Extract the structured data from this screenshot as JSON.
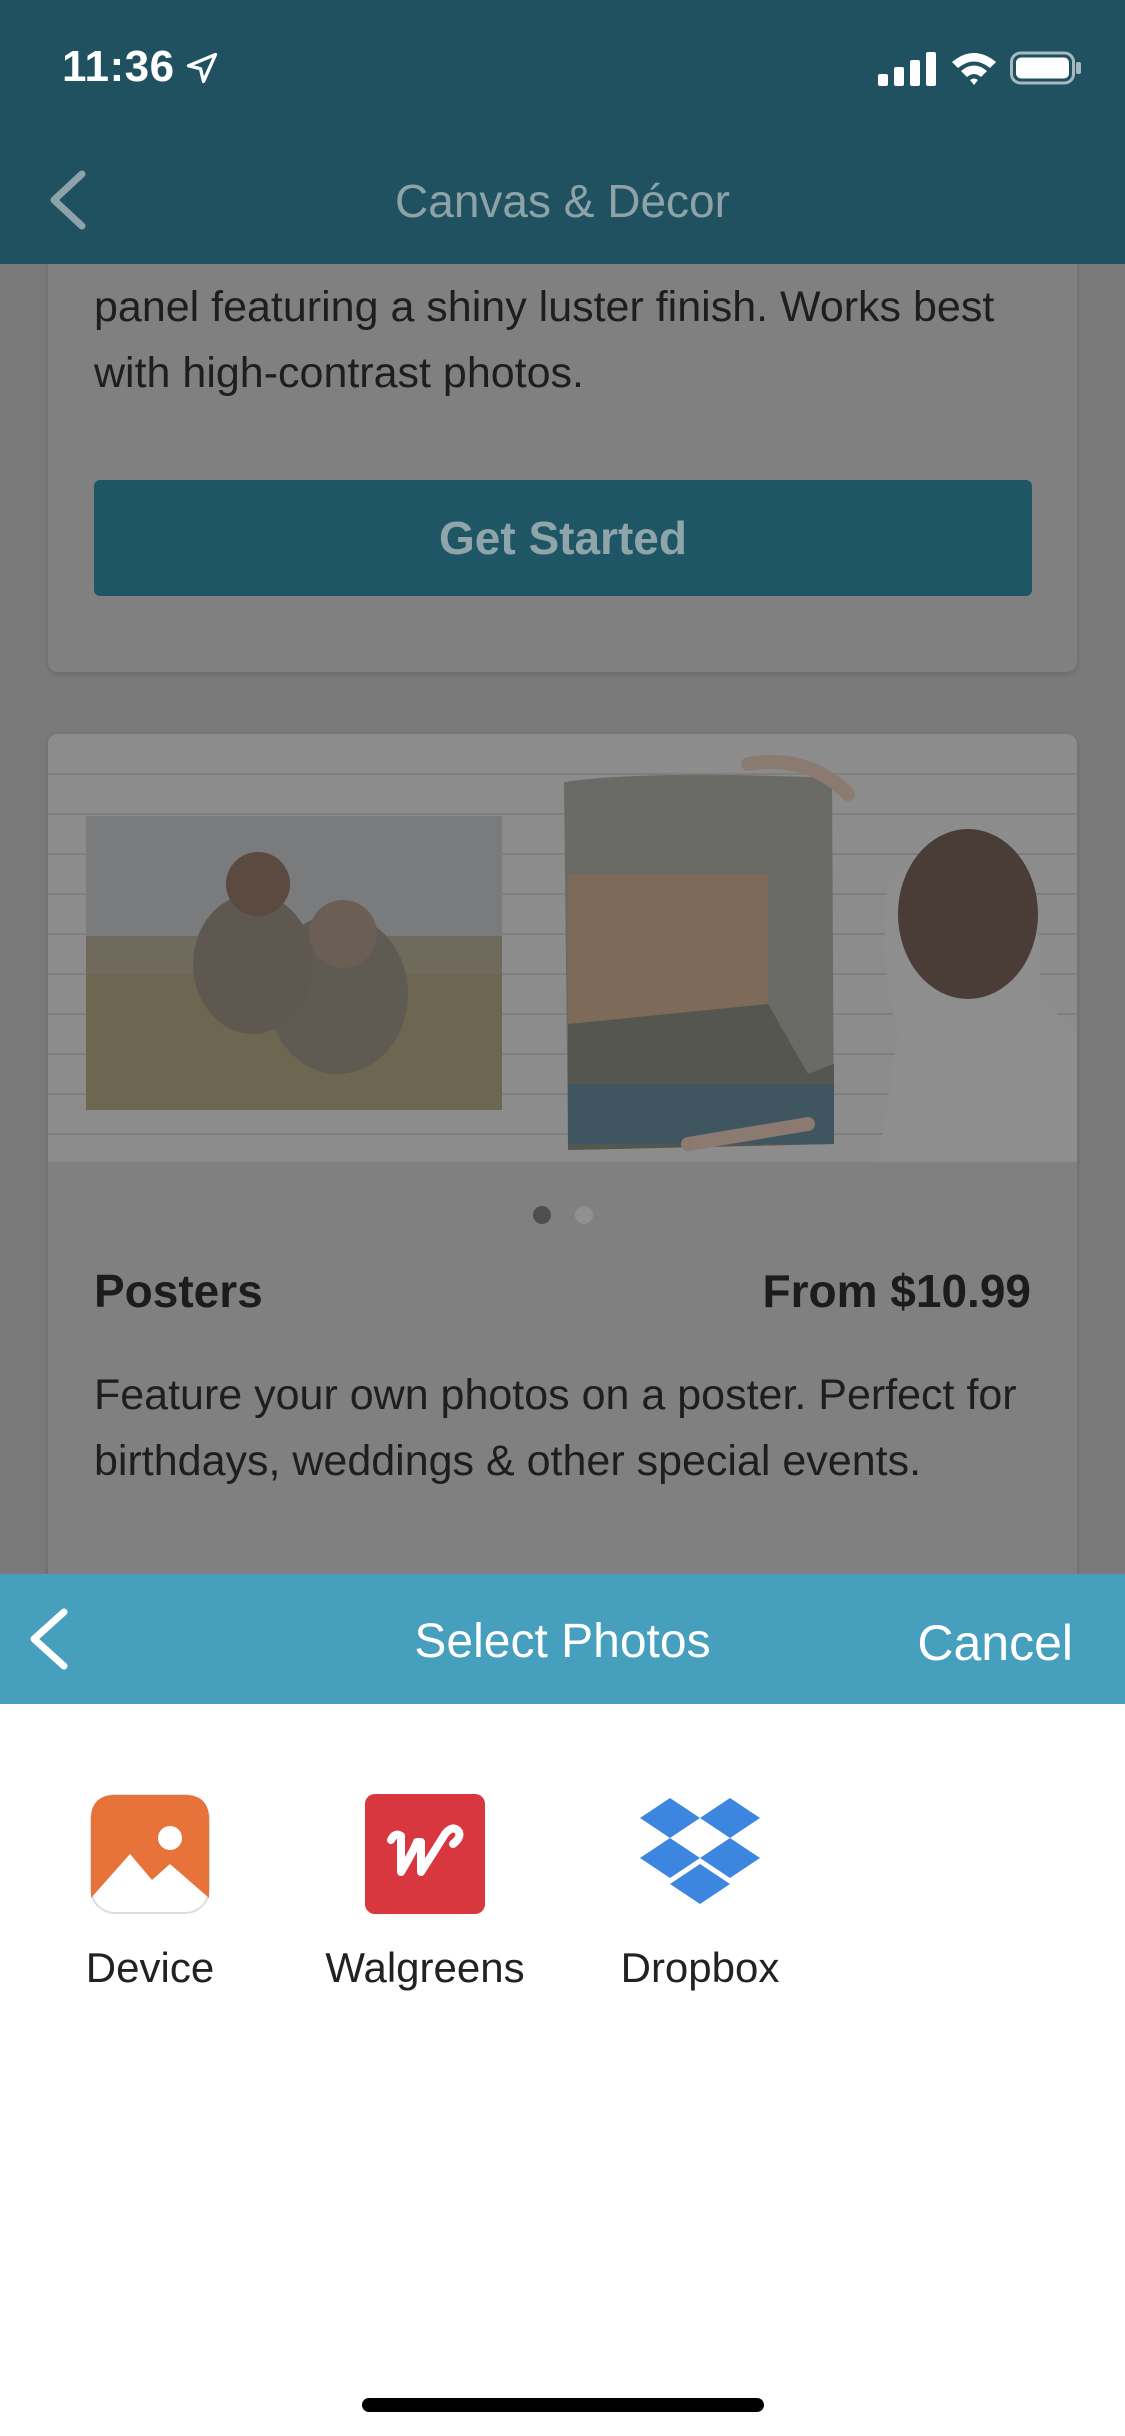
{
  "status_bar": {
    "time": "11:36"
  },
  "nav": {
    "title": "Canvas & Décor"
  },
  "top_card": {
    "description": "panel featuring a shiny luster finish. Works best with high-contrast photos.",
    "button_label": "Get Started"
  },
  "poster_card": {
    "title": "Posters",
    "price": "From $10.99",
    "description": "Feature your own photos on a poster. Perfect for birthdays, weddings & other special events.",
    "carousel_active_index": 0,
    "carousel_count": 2
  },
  "sheet": {
    "title": "Select Photos",
    "cancel_label": "Cancel",
    "sources": [
      {
        "label": "Device",
        "icon": "photos-app-icon"
      },
      {
        "label": "Walgreens",
        "icon": "walgreens-logo-icon"
      },
      {
        "label": "Dropbox",
        "icon": "dropbox-logo-icon"
      }
    ]
  },
  "colors": {
    "nav_bar": "#1f5160",
    "sheet_header": "#459fbd",
    "button": "#1f5666",
    "device_icon": "#e8733a",
    "walgreens_icon": "#d8373f",
    "dropbox_icon": "#3d86e0"
  }
}
